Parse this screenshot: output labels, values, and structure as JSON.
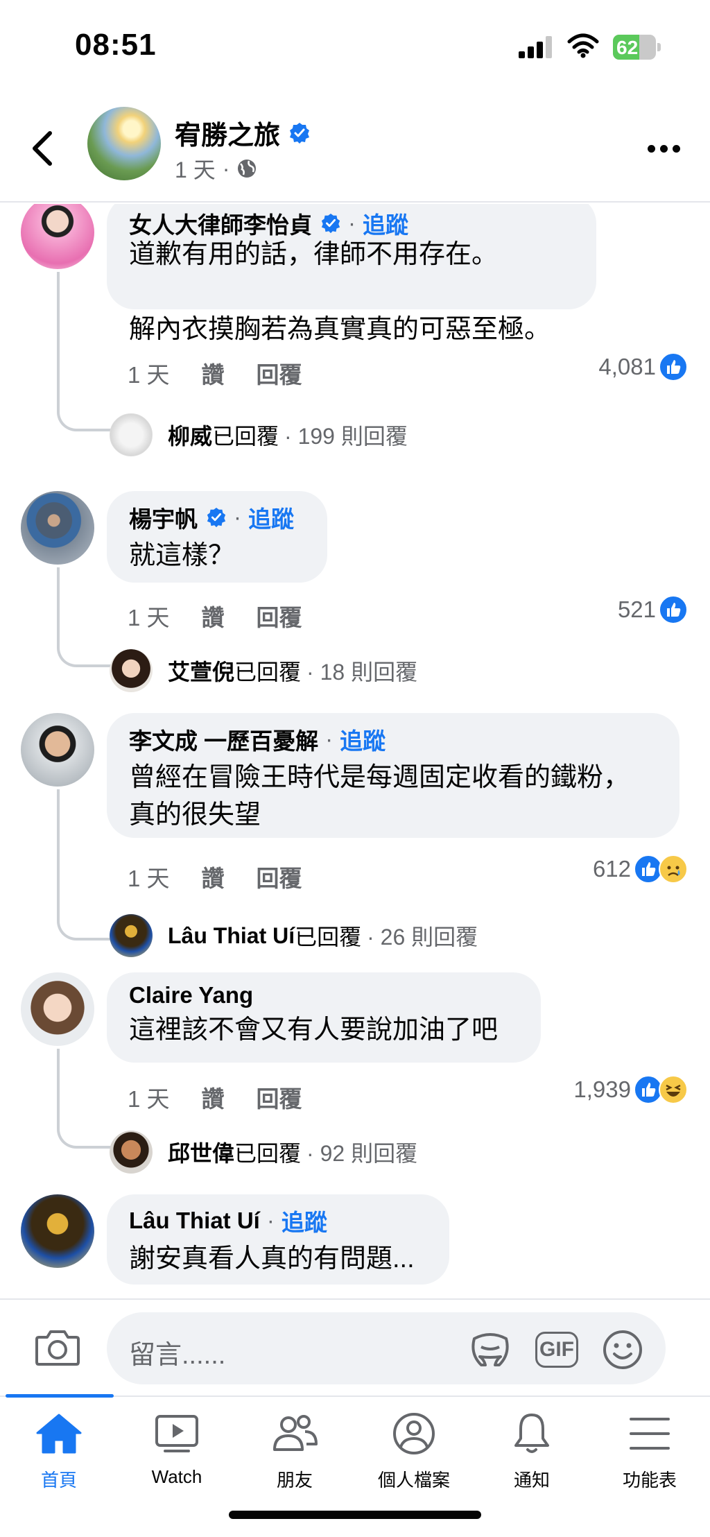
{
  "status": {
    "time": "08:51",
    "battery": "62",
    "battery_level": 0.62
  },
  "header": {
    "page_name": "宥勝之旅",
    "time_ago": "1 天",
    "separator": "·"
  },
  "comment_actions": {
    "like": "讚",
    "reply": "回覆"
  },
  "comments": [
    {
      "author": "女人大律師李怡貞",
      "verified": true,
      "follow": "追蹤",
      "text": "道歉有用的話，律師不用存在。\n\n解內衣摸胸若為真實真的可惡至極。",
      "time": "1 天",
      "reaction_count": "4,081",
      "reactions": [
        "like"
      ],
      "reply_by": "柳威",
      "reply_replied": "已回覆",
      "reply_count": "· 199 則回覆"
    },
    {
      "author": "楊宇帆",
      "verified": true,
      "follow": "追蹤",
      "text": "就這樣？",
      "time": "1 天",
      "reaction_count": "521",
      "reactions": [
        "like"
      ],
      "reply_by": "艾萱倪",
      "reply_replied": "已回覆",
      "reply_count": "· 18 則回覆"
    },
    {
      "author": "李文成 一歷百憂解",
      "verified": false,
      "follow": "追蹤",
      "text": "曾經在冒險王時代是每週固定收看的鐵粉，\n真的很失望",
      "time": "1 天",
      "reaction_count": "612",
      "reactions": [
        "like",
        "sad"
      ],
      "reply_by": "Lâu Thiat Uí",
      "reply_replied": "已回覆",
      "reply_count": "· 26 則回覆"
    },
    {
      "author": "Claire Yang",
      "verified": false,
      "follow": "",
      "text": "這裡該不會又有人要說加油了吧",
      "time": "1 天",
      "reaction_count": "1,939",
      "reactions": [
        "like",
        "haha"
      ],
      "reply_by": "邱世偉",
      "reply_replied": "已回覆",
      "reply_count": "· 92 則回覆"
    },
    {
      "author": "Lâu Thiat Uí",
      "verified": false,
      "follow": "追蹤",
      "text": "謝安真看人真的有問題...",
      "time": "",
      "reaction_count": "",
      "reactions": [],
      "reply_by": "",
      "reply_replied": "",
      "reply_count": ""
    }
  ],
  "composer": {
    "placeholder": "留言......",
    "gif_label": "GIF"
  },
  "tabs": [
    {
      "label": "首頁",
      "icon": "home-icon",
      "active": true
    },
    {
      "label": "Watch",
      "icon": "watch-icon",
      "active": false
    },
    {
      "label": "朋友",
      "icon": "friends-icon",
      "active": false
    },
    {
      "label": "個人檔案",
      "icon": "profile-icon",
      "active": false
    },
    {
      "label": "通知",
      "icon": "bell-icon",
      "active": false
    },
    {
      "label": "功能表",
      "icon": "menu-icon",
      "active": false
    }
  ],
  "colors": {
    "accent": "#1877f2",
    "bubble": "#f0f2f5",
    "secondary_text": "#65676b"
  }
}
